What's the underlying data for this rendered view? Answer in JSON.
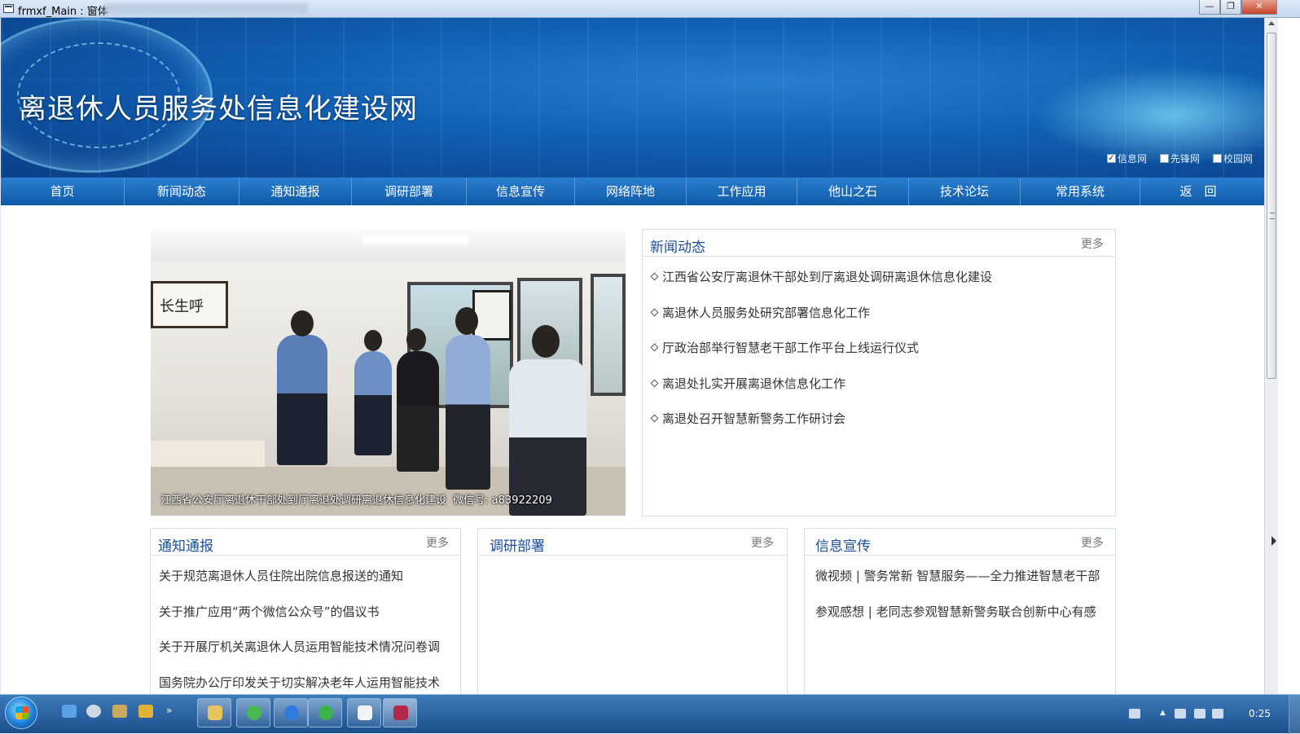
{
  "window": {
    "title": "frmxf_Main : 窗体"
  },
  "banner": {
    "site_title": "离退休人员服务处信息化建设网",
    "networks": [
      {
        "label": "信息网",
        "checked": true
      },
      {
        "label": "先锋网",
        "checked": false
      },
      {
        "label": "校园网",
        "checked": false
      }
    ]
  },
  "nav": {
    "items": [
      "首页",
      "新闻动态",
      "通知通报",
      "调研部署",
      "信息宣传",
      "网络阵地",
      "工作应用",
      "他山之石",
      "技术论坛",
      "常用系统",
      "返　回"
    ]
  },
  "slide": {
    "caption": "江西省公安厅离退休干部处到厅离退处调研离退休信息化建设",
    "watermark": "微信号: a83922209"
  },
  "news": {
    "title": "新闻动态",
    "more": "更多",
    "items": [
      "江西省公安厅离退休干部处到厅离退处调研离退休信息化建设",
      "离退休人员服务处研究部署信息化工作",
      "厅政治部举行智慧老干部工作平台上线运行仪式",
      "离退处扎实开展离退休信息化工作",
      "离退处召开智慧新警务工作研讨会"
    ]
  },
  "notices": {
    "title": "通知通报",
    "more": "更多",
    "items": [
      "关于规范离退休人员住院出院信息报送的通知",
      "关于推广应用“两个微信公众号”的倡议书",
      "关于开展厅机关离退休人员运用智能技术情况问卷调",
      "国务院办公厅印发关于切实解决老年人运用智能技术"
    ]
  },
  "research": {
    "title": "调研部署",
    "more": "更多",
    "items": []
  },
  "publicity": {
    "title": "信息宣传",
    "more": "更多",
    "items": [
      "微视频 | 警务常新 智慧服务——全力推进智慧老干部",
      "参观感想 | 老同志参观智慧新警务联合创新中心有感"
    ]
  },
  "taskbar": {
    "clock": "0:25"
  },
  "colors": {
    "nav_bg": "#1b6bbd",
    "panel_title": "#1a4f9e",
    "banner_base": "#115fb3"
  }
}
